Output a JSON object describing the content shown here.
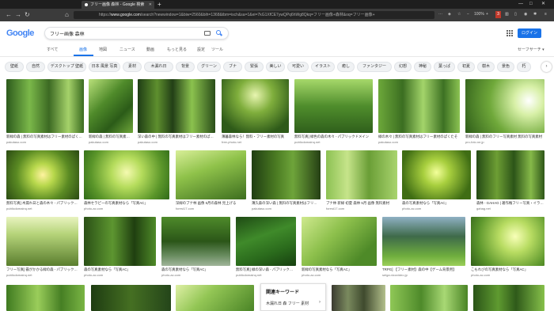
{
  "browser": {
    "tab_title": "フリー画像 森林 - Google 検索",
    "new_tab": "+",
    "url_host": "www.google.com",
    "url_prefix": "https://",
    "url_rest": "/search?newwindow=1&biw=2560&bih=1368&tbm=isch&sa=1&ei=7kG1XfCE7ywQPq6hWg8Qkq=フリー画像+森林&oq=フリー画像+",
    "zoom": "100%",
    "tab_count": "3"
  },
  "google": {
    "logo": "Google",
    "search_value": "フリー画像 森林",
    "login_label": "ログイン",
    "safesearch": "セーフサーチ ▾",
    "tabs": [
      "すべて",
      "画像",
      "地図",
      "ニュース",
      "動画",
      "もっと見る",
      "設定",
      "ツール"
    ],
    "active_tab": "画像"
  },
  "chips": [
    "壁紙",
    "自然",
    "デスクトップ 壁紙",
    "日本 風景 写真",
    "素材",
    "木漏れ日",
    "背景",
    "グリーン",
    "ブナ",
    "緊張",
    "美しい",
    "可愛い",
    "イラスト",
    "癒し",
    "ファンタジー",
    "幻想",
    "神秘",
    "葉っぱ",
    "初夏",
    "樹木",
    "景色",
    "朽"
  ],
  "results": [
    {
      "caption": "新緑の森 | 無料の写真素材はフリー素材のぱくたそ",
      "source": "pakutaso.com"
    },
    {
      "caption": "新緑の森 | 無料の写真素材はフリー素材のぱくたそ",
      "source": "pakutaso.com"
    },
    {
      "caption": "深い森の中 | 無料の写真素材はフリー素材のぱくたそ",
      "source": "pakutaso.com"
    },
    {
      "caption": "薄暮森林なら！無料・フリー素材の写真",
      "source": "free-photo.net"
    },
    {
      "caption": "無料写真] 緑色の森の木々 - パブリックドメイン",
      "source": "publicdomainq.net"
    },
    {
      "caption": "緑の木々 | 無料の写真素材はフリー素材のぱくたそ",
      "source": "pakutaso.com"
    },
    {
      "caption": "新緑の森 | 無料のフリー写真素材 無料の写真素材",
      "source": "pro-foto.ne.jp"
    },
    {
      "caption": "無料写真] 木漏れ日と森の木々 - パブリックドメイン",
      "source": "publicdomainq.net"
    },
    {
      "caption": "森林セラピーの写真素材なら「写真AC」",
      "source": "photo-ac.com"
    },
    {
      "caption": "深緑のブナ林 画像 5月の森林 見上げる",
      "source": "forest17.com"
    },
    {
      "caption": "薄久森の深い森 | 無料の写真素材はフリー素材の",
      "source": "pakutaso.com"
    },
    {
      "caption": "ブナ林 新緑 初夏 森林 5月 画像 無料素材",
      "source": "forest17.com"
    },
    {
      "caption": "森の写真素材なら「写真AC」",
      "source": "photo-ac.com"
    },
    {
      "caption": "森林 - GAHAG | 著作権フリー写真・イラスト",
      "source": "gahag.net"
    },
    {
      "caption": "フリー写真] 霧がかかる緑の森 - パブリックドメイン",
      "source": "publicdomainq.net"
    },
    {
      "caption": "森の写真素材なら「写真AC」",
      "source": "photo-ac.com"
    },
    {
      "caption": "森の写真素材なら「写真AC」",
      "source": "photo-ac.com"
    },
    {
      "caption": "無料写真] 緑の深い森 - パブリックドメインQ",
      "source": "publicdomainq.net"
    },
    {
      "caption": "新緑の写真素材なら「写真AC」",
      "source": "photo-ac.com"
    },
    {
      "caption": "TRPG] 【フリー素材】森の中【ゲーム背景用】",
      "source": "seiga.nicovideo.jp"
    },
    {
      "caption": "こもれびの写真素材なら「写真AC」",
      "source": "photo-ac.com"
    }
  ],
  "related": {
    "title": "関連キーワード",
    "keyword": "木漏れ日 森 フリー 素材",
    "arrow": "›"
  },
  "colors": {
    "accent": "#1a73e8",
    "chip_bg": "#f0f2f4"
  }
}
